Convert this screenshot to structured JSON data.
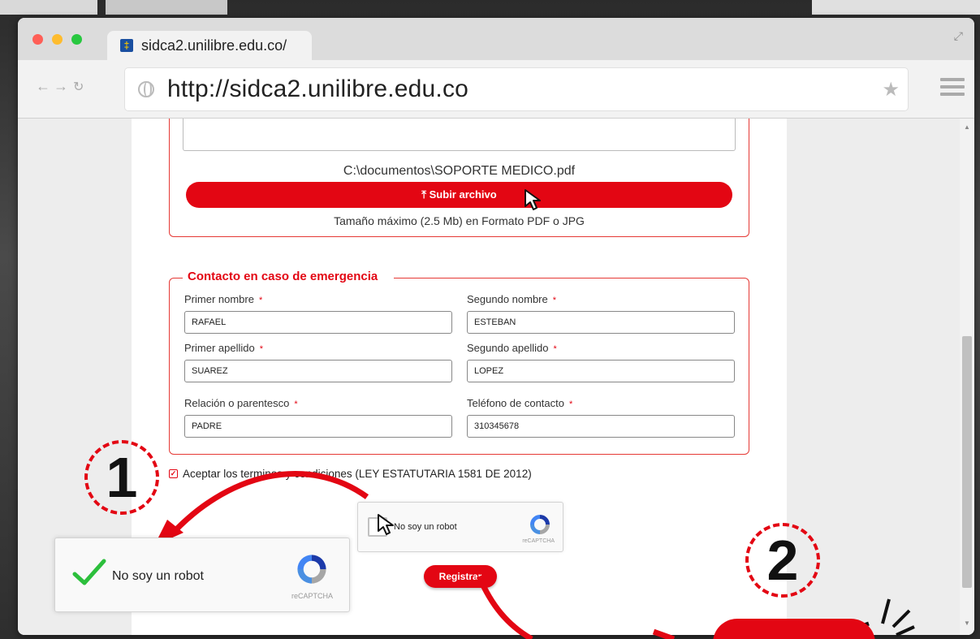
{
  "browser": {
    "tab_title": "sidca2.unilibre.edu.co/",
    "url": "http://sidca2.unilibre.edu.co"
  },
  "upload": {
    "file_path": "C:\\documentos\\SOPORTE MEDICO.pdf",
    "button_label": "Subir archivo",
    "hint": "Tamaño máximo (2.5 Mb) en Formato PDF o JPG"
  },
  "emergency_contact": {
    "legend": "Contacto en caso de emergencia",
    "required_mark": "*",
    "fields": [
      {
        "label": "Primer nombre",
        "value": "RAFAEL"
      },
      {
        "label": "Segundo nombre",
        "value": "ESTEBAN"
      },
      {
        "label": "Primer apellido",
        "value": "SUAREZ"
      },
      {
        "label": "Segundo apellido",
        "value": "LOPEZ"
      },
      {
        "label": "Relación o parentesco",
        "value": "PADRE"
      },
      {
        "label": "Teléfono de contacto",
        "value": "310345678"
      }
    ]
  },
  "terms": {
    "label": "Aceptar los terminos y condiciones (LEY ESTATUTARIA 1581 DE 2012)",
    "checked": true
  },
  "captcha": {
    "label": "No soy un robot",
    "brand": "reCAPTCHA"
  },
  "register_button": "Registrar",
  "annotations": {
    "step1": "1",
    "step2": "2"
  },
  "colors": {
    "accent": "#e30613",
    "check_green": "#2cbf3c"
  }
}
